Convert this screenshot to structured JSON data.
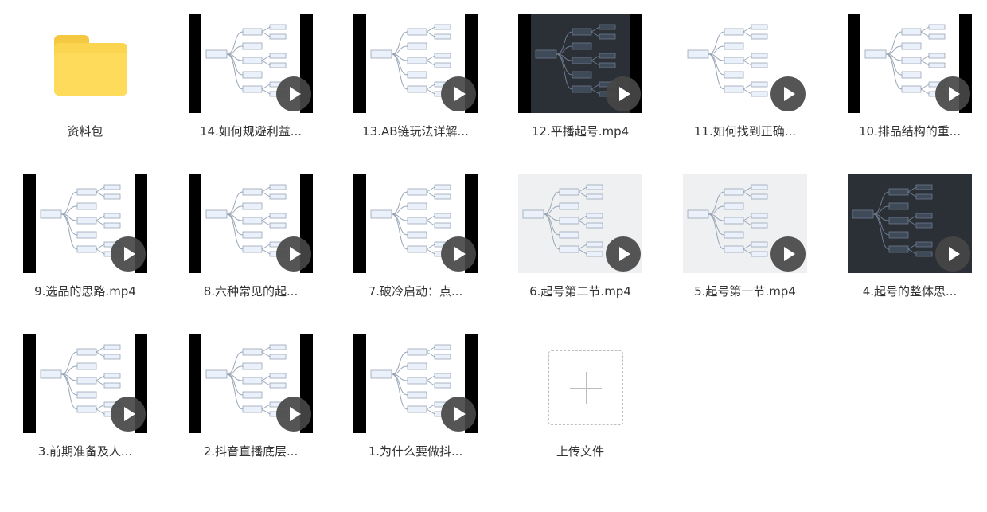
{
  "files": [
    {
      "name": "资料包",
      "type": "folder"
    },
    {
      "name": "14.如何规避利益...",
      "type": "video",
      "theme": "white"
    },
    {
      "name": "13.AB链玩法详解...",
      "type": "video",
      "theme": "white"
    },
    {
      "name": "12.平播起号.mp4",
      "type": "video",
      "theme": "dark"
    },
    {
      "name": "11.如何找到正确...",
      "type": "video",
      "theme": "white"
    },
    {
      "name": "10.排品结构的重...",
      "type": "video",
      "theme": "white"
    },
    {
      "name": "9.选品的思路.mp4",
      "type": "video",
      "theme": "white"
    },
    {
      "name": "8.六种常见的起...",
      "type": "video",
      "theme": "white"
    },
    {
      "name": "7.破冷启动：点...",
      "type": "video",
      "theme": "white"
    },
    {
      "name": "6.起号第二节.mp4",
      "type": "video",
      "theme": "gray"
    },
    {
      "name": "5.起号第一节.mp4",
      "type": "video",
      "theme": "gray"
    },
    {
      "name": "4.起号的整体思...",
      "type": "video",
      "theme": "dark"
    },
    {
      "name": "3.前期准备及人...",
      "type": "video",
      "theme": "white"
    },
    {
      "name": "2.抖音直播底层...",
      "type": "video",
      "theme": "white"
    },
    {
      "name": "1.为什么要做抖...",
      "type": "video",
      "theme": "white"
    },
    {
      "name": "上传文件",
      "type": "upload"
    }
  ],
  "icons": {
    "folder": "folder-icon",
    "play": "play-icon",
    "upload": "plus-icon"
  },
  "colors": {
    "folder": "#fbd54f",
    "play_overlay": "#464646",
    "upload_border": "#bdbdbd",
    "label_text": "#333333"
  }
}
